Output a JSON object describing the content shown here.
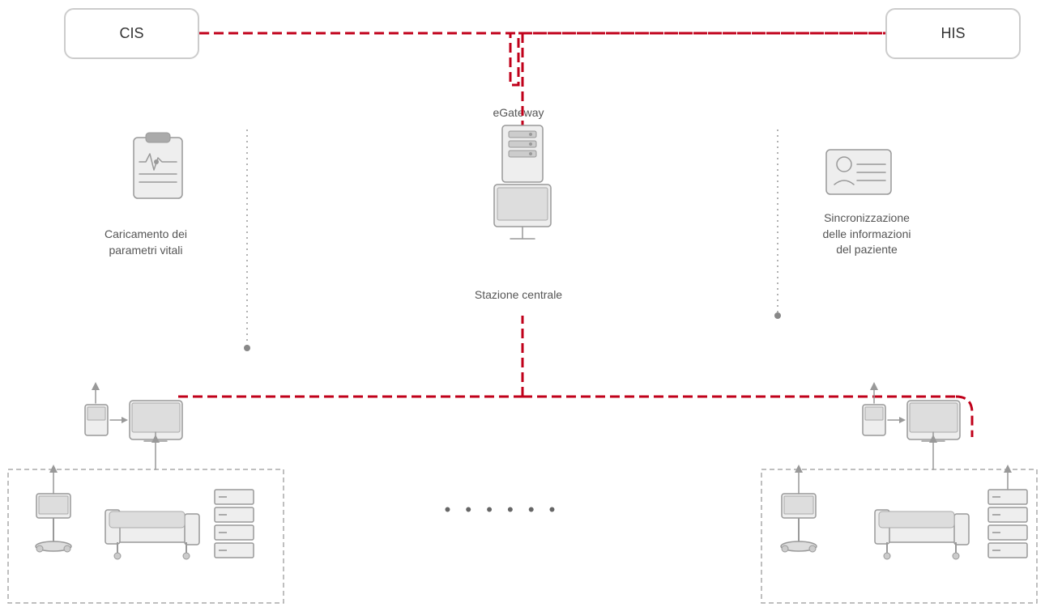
{
  "labels": {
    "cis": "CIS",
    "his": "HIS",
    "egateway": "eGateway",
    "stazione_centrale": "Stazione centrale",
    "caricamento": "Caricamento dei\nparametri vitali",
    "sincronizzazione": "Sincronizzazione\ndelle informazioni\ndel paziente",
    "dots": "• • • • • •"
  },
  "colors": {
    "red": "#c0001a",
    "gray": "#aaa",
    "dark_gray": "#666",
    "light_gray": "#ccc",
    "icon_stroke": "#999"
  }
}
